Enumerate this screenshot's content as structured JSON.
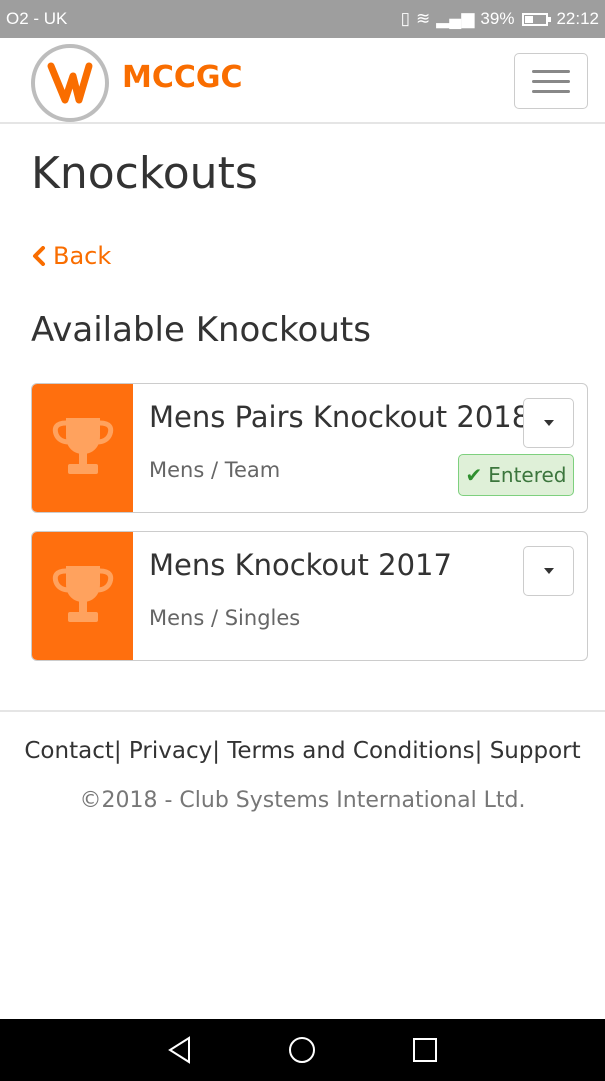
{
  "status_bar": {
    "carrier": "O2 - UK",
    "battery_pct": "39%",
    "time": "22:12"
  },
  "header": {
    "brand": "MCCGC"
  },
  "page": {
    "title": "Knockouts",
    "back_label": "Back",
    "section_title": "Available Knockouts"
  },
  "knockouts": [
    {
      "title": "Mens Pairs Knockout 2018",
      "subtitle": "Mens / Team",
      "status": "Entered"
    },
    {
      "title": "Mens Knockout 2017",
      "subtitle": "Mens / Singles",
      "status": ""
    }
  ],
  "footer": {
    "links": [
      "Contact",
      "Privacy",
      "Terms and Conditions",
      "Support"
    ],
    "copyright": "©2018 - Club Systems International Ltd."
  },
  "colors": {
    "accent": "#f96d00",
    "card_thumb": "#ff6f0e",
    "entered_bg": "#dff0d8",
    "entered_text": "#3c763d"
  }
}
